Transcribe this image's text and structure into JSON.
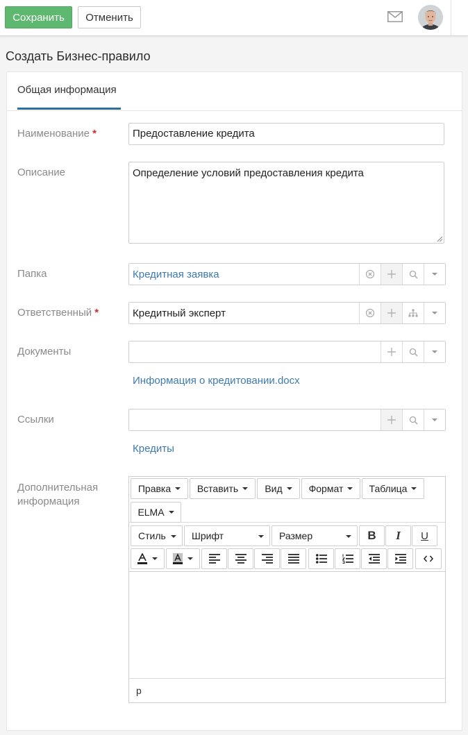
{
  "toolbar": {
    "save_label": "Сохранить",
    "cancel_label": "Отменить",
    "mail_icon": "mail-icon",
    "avatar_icon": "user-avatar"
  },
  "page": {
    "title": "Создать Бизнес-правило"
  },
  "tabs": [
    {
      "label": "Общая информация",
      "active": true
    }
  ],
  "form": {
    "name": {
      "label": "Наименование",
      "required_mark": "*",
      "value": "Предоставление кредита"
    },
    "description": {
      "label": "Описание",
      "value": "Определение условий предоставления кредита"
    },
    "folder": {
      "label": "Папка",
      "value": "Кредитная заявка"
    },
    "responsible": {
      "label": "Ответственный",
      "required_mark": "*",
      "value": "Кредитный эксперт"
    },
    "documents": {
      "label": "Документы",
      "value": "",
      "items": [
        "Информация о кредитовании.docx"
      ]
    },
    "links": {
      "label": "Ссылки",
      "value": "",
      "items": [
        "Кредиты"
      ]
    },
    "additional": {
      "label_line1": "Дополнительная",
      "label_line2": "информация"
    }
  },
  "editor": {
    "menus": [
      "Правка",
      "Вставить",
      "Вид",
      "Формат",
      "Таблица",
      "ELMA"
    ],
    "style_select": "Стиль",
    "font_select": "Шрифт",
    "size_select": "Размер",
    "format_buttons": [
      "B",
      "I",
      "U"
    ],
    "buttons": [
      "text-color",
      "background-color",
      "align-left",
      "align-center",
      "align-right",
      "align-justify",
      "bullet-list",
      "numbered-list",
      "outdent",
      "indent",
      "source-code"
    ],
    "status_path": "p"
  },
  "colors": {
    "accent": "#2b6f9e",
    "save": "#5fb86f",
    "link": "#3d7bb0",
    "required": "#c9302c"
  }
}
